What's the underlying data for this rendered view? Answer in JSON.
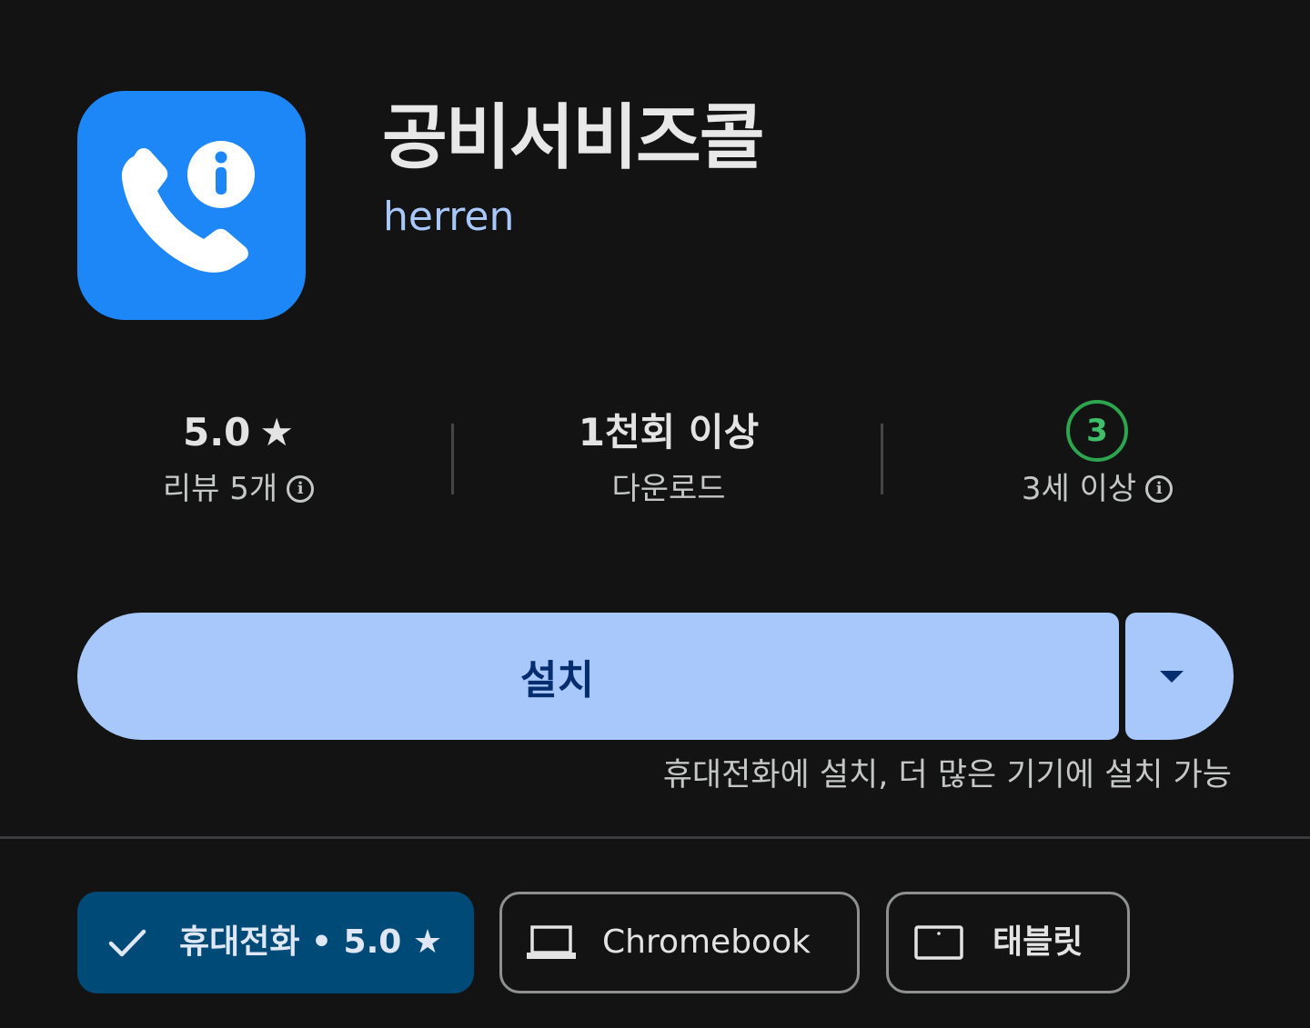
{
  "app": {
    "icon": "phone-with-info-icon",
    "title": "공비서비즈콜",
    "developer": "herren"
  },
  "stats": {
    "rating": {
      "value": "5.0",
      "star": "★",
      "label": "리뷰 5개"
    },
    "downloads": {
      "value": "1천회 이상",
      "label": "다운로드"
    },
    "age": {
      "badge": "3",
      "label": "3세 이상"
    }
  },
  "install": {
    "button_label": "설치",
    "note": "휴대전화에 설치, 더 많은 기기에 설치 가능"
  },
  "devices": [
    {
      "label": "휴대전화 • 5.0",
      "star": "★",
      "selected": true,
      "icon": "check-icon"
    },
    {
      "label": "Chromebook",
      "selected": false,
      "icon": "laptop-icon"
    },
    {
      "label": "태블릿",
      "selected": false,
      "icon": "tablet-icon"
    }
  ],
  "colors": {
    "background": "#131314",
    "accent": "#a8c7fa",
    "app_icon": "#1e87f8",
    "age_badge": "#2da44e",
    "selected_chip": "#004a77"
  }
}
